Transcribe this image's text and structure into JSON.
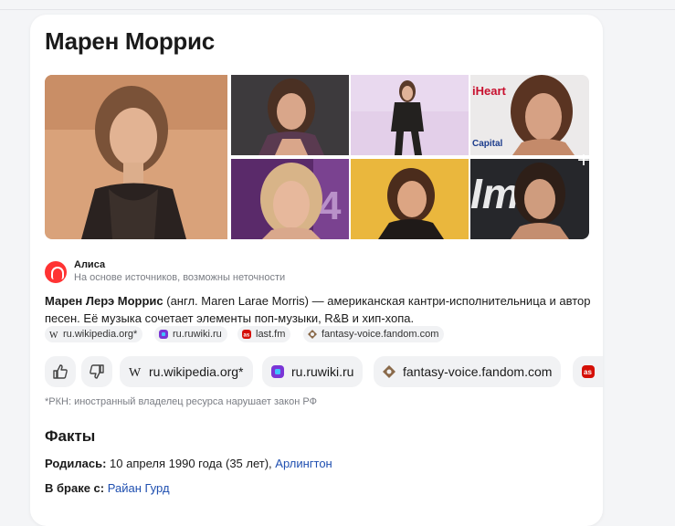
{
  "title": "Марен Моррис",
  "alisa": {
    "name": "Алиса",
    "subtitle": "На основе источников, возможны неточности"
  },
  "description": {
    "bold": "Марен Лерэ Моррис",
    "rest": " (англ. Maren Larae Morris) — американская кантри-исполнительница и автор песен. Её музыка сочетает элементы поп-музыки, R&B и хип-хопа."
  },
  "sources": [
    {
      "label": "ru.wikipedia.org*",
      "icon": "wikipedia-icon"
    },
    {
      "label": "ru.ruwiki.ru",
      "icon": "ruwiki-icon"
    },
    {
      "label": "last.fm",
      "icon": "lastfm-icon"
    },
    {
      "label": "fantasy-voice.fandom.com",
      "icon": "fandom-icon"
    }
  ],
  "chips": [
    {
      "label": "ru.wikipedia.org*",
      "icon": "wikipedia-icon"
    },
    {
      "label": "ru.ruwiki.ru",
      "icon": "ruwiki-icon"
    },
    {
      "label": "fantasy-voice.fandom.com",
      "icon": "fandom-icon"
    }
  ],
  "rkn_note": "*РКН: иностранный владелец ресурса нарушает закон РФ",
  "facts": {
    "heading": "Факты",
    "born_label": "Родилась:",
    "born_value": " 10 апреля 1990 года (35 лет),",
    "born_place": "Арлингтон",
    "married_label": "В браке с:",
    "married_value": "Райан Гурд"
  },
  "gallery": {
    "more_icon": "plus-icon",
    "tile_labels": [
      "iHeart",
      "Capital",
      "4"
    ]
  },
  "colors": {
    "link": "#1f4fb0",
    "alisa_red": "#ff3333",
    "chip_bg": "#f1f2f4"
  }
}
